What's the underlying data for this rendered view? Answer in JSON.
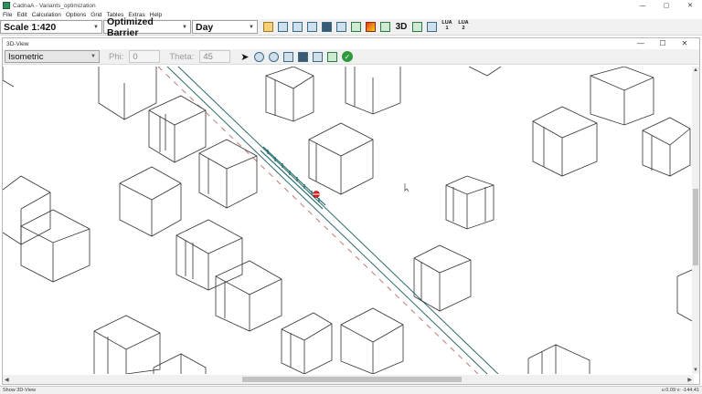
{
  "app": {
    "title": "CadnaA - Variants_optimization"
  },
  "menu": [
    "File",
    "Edit",
    "Calculation",
    "Options",
    "Grid",
    "Tables",
    "Extras",
    "Help"
  ],
  "toolbar": {
    "scale": "Scale 1:420",
    "variant": "Optimized Barrier",
    "period": "Day",
    "view3d": "3D",
    "lua1_top": "LUA",
    "lua1_num": "1",
    "lua2_top": "LUA",
    "lua2_num": "2"
  },
  "view_window": {
    "title": "3D-View",
    "projection": "Isometric",
    "phi_label": "Phi:",
    "phi_value": "0",
    "theta_label": "Theta:",
    "theta_value": "45"
  },
  "status": {
    "left": "Show 3D-View",
    "right": "u 0.09  v: -144.41"
  },
  "colors": {
    "road_line": "#2d6a6a",
    "road_dash": "#c07a7a",
    "barrier": "#1a6a6a",
    "building": "#333333"
  }
}
